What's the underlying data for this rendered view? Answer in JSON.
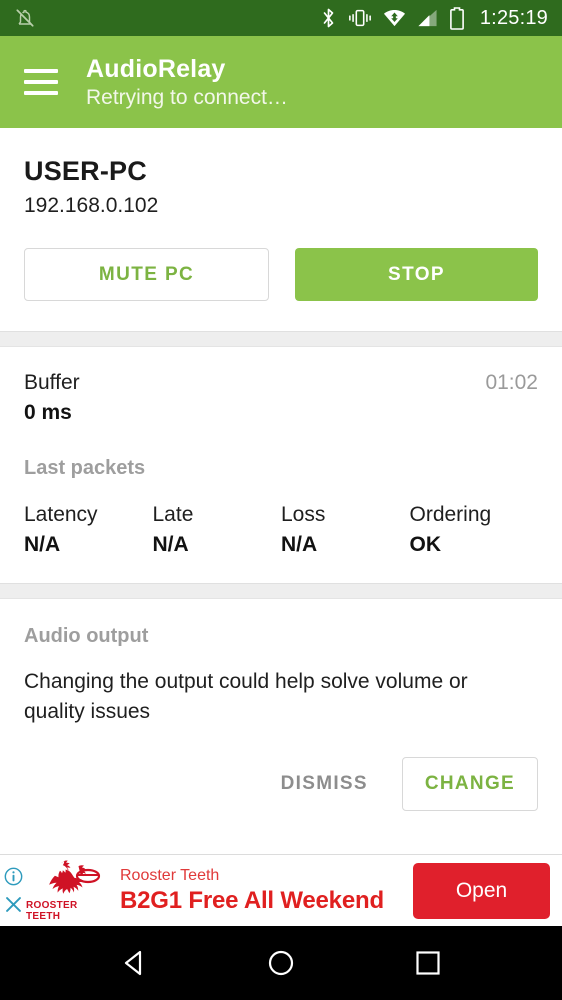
{
  "status_bar": {
    "left_icons": [
      {
        "name": "muted-notification-icon"
      }
    ],
    "right_icons": [
      {
        "name": "bluetooth-icon"
      },
      {
        "name": "vibrate-icon"
      },
      {
        "name": "wifi-icon"
      },
      {
        "name": "cellular-signal-icon"
      },
      {
        "name": "battery-icon"
      }
    ],
    "battery_level": "53",
    "clock": "1:25:19",
    "background_color": "#2f6b1e"
  },
  "app_bar": {
    "menu_icon": "hamburger-menu-icon",
    "title": "AudioRelay",
    "subtitle": "Retrying to connect…",
    "background_color": "#8bc34a"
  },
  "server": {
    "name": "USER-PC",
    "ip": "192.168.0.102",
    "mute_label": "MUTE PC",
    "stop_label": "STOP"
  },
  "stats": {
    "buffer_label": "Buffer",
    "buffer_value": "0 ms",
    "timer": "01:02",
    "packets_caption": "Last packets",
    "packets": [
      {
        "label": "Latency",
        "value": "N/A"
      },
      {
        "label": "Late",
        "value": "N/A"
      },
      {
        "label": "Loss",
        "value": "N/A"
      },
      {
        "label": "Ordering",
        "value": "OK"
      }
    ]
  },
  "audio_output": {
    "caption": "Audio output",
    "body": "Changing the output could help solve volume or quality issues",
    "dismiss_label": "DISMISS",
    "change_label": "CHANGE"
  },
  "ad": {
    "info_icon": "ad-info-icon",
    "close_icon": "ad-close-icon",
    "logo_text": "ROOSTER TEETH",
    "brand": "Rooster Teeth",
    "headline": "B2G1 Free All Weekend",
    "cta_label": "Open",
    "cta_color": "#e0202c"
  },
  "nav_bar": {
    "back": "back-nav-icon",
    "home": "home-nav-icon",
    "recents": "recents-nav-icon"
  }
}
